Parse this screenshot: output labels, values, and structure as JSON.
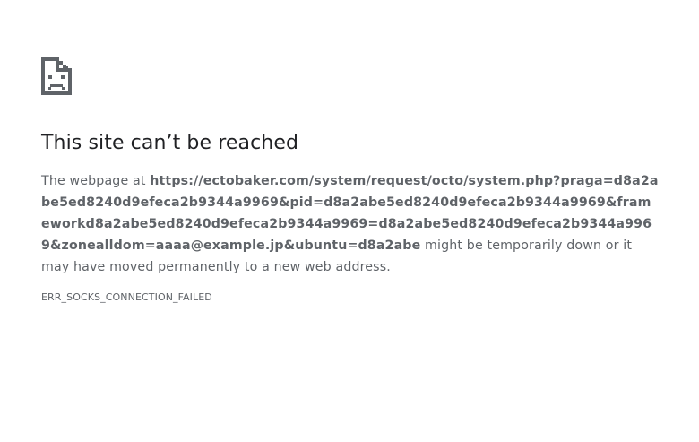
{
  "error_page": {
    "icon": "sad-document-icon",
    "title": "This site can’t be reached",
    "message_prefix": "The webpage at ",
    "url": "https://ectobaker.com/system/request/octo/system.php?praga=d8a2abe5ed8240d9efeca2b9344a9969&pid=d8a2abe5ed8240d9efeca2b9344a9969&frameworkd8a2abe5ed8240d9efeca2b9344a9969=d8a2abe5ed8240d9efeca2b9344a9969&zonealldom=aaaa@example.jp&ubuntu=d8a2abe",
    "message_suffix": " might be temporarily down or it may have moved permanently to a new web address.",
    "error_code": "ERR_SOCKS_CONNECTION_FAILED"
  },
  "colors": {
    "title": "#202124",
    "text": "#5f6368",
    "icon": "#5f6368",
    "background": "#ffffff"
  }
}
